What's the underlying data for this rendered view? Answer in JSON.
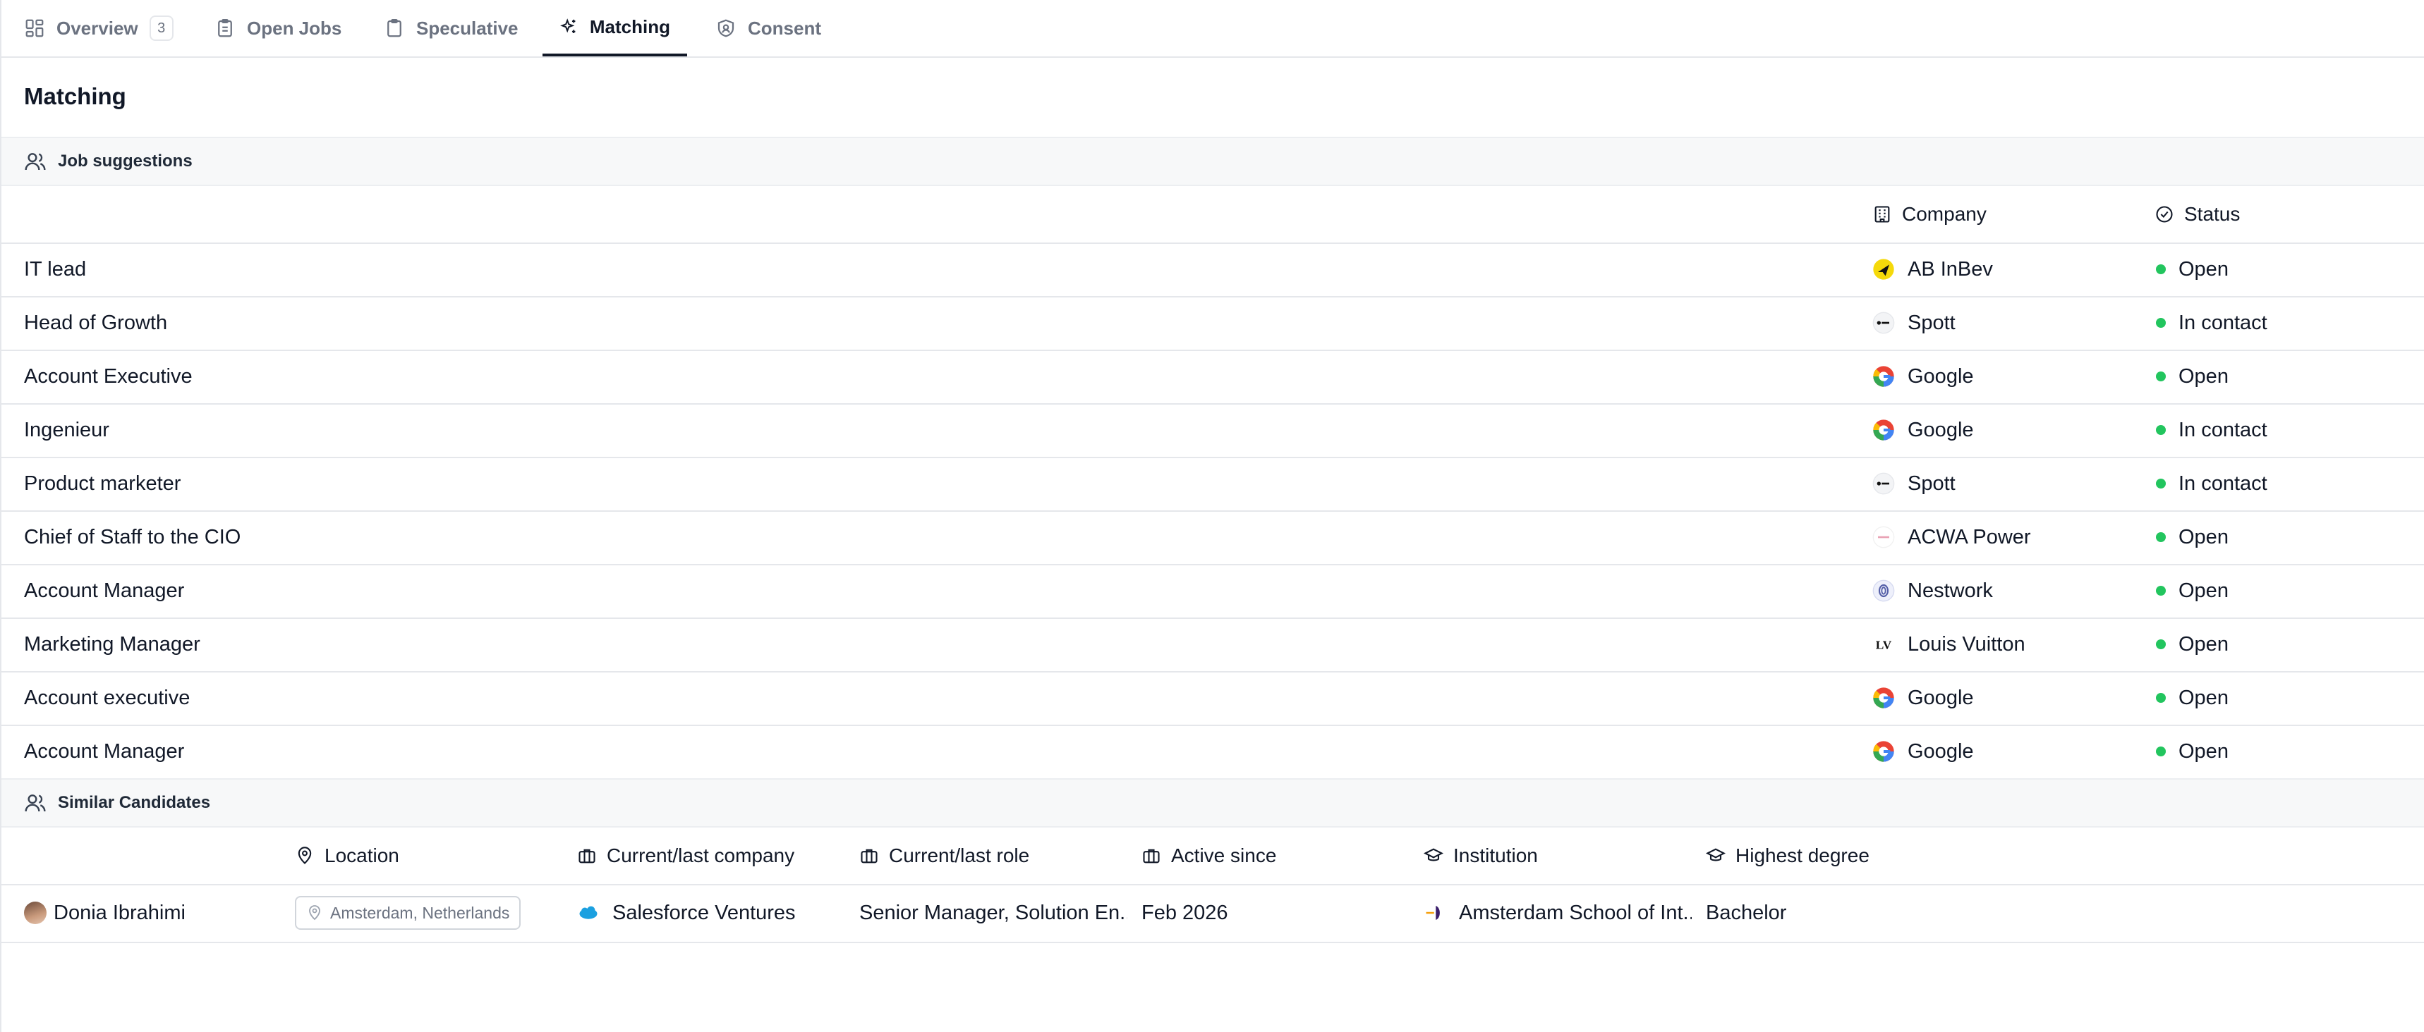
{
  "tabs": [
    {
      "label": "Overview",
      "count": "3",
      "icon": "grid-icon"
    },
    {
      "label": "Open Jobs",
      "icon": "clipboard-list-icon"
    },
    {
      "label": "Speculative",
      "icon": "clipboard-icon"
    },
    {
      "label": "Matching",
      "icon": "sparkles-icon",
      "active": true
    },
    {
      "label": "Consent",
      "icon": "shield-icon"
    }
  ],
  "page_title": "Matching",
  "job_suggestions": {
    "title": "Job suggestions",
    "columns": {
      "company": "Company",
      "status": "Status"
    },
    "rows": [
      {
        "title": "IT lead",
        "company": "AB InBev",
        "logo": "abinbev",
        "status": "Open"
      },
      {
        "title": "Head of Growth",
        "company": "Spott",
        "logo": "spott",
        "status": "In contact"
      },
      {
        "title": "Account Executive",
        "company": "Google",
        "logo": "google",
        "status": "Open"
      },
      {
        "title": "Ingenieur",
        "company": "Google",
        "logo": "google",
        "status": "In contact"
      },
      {
        "title": "Product marketer",
        "company": "Spott",
        "logo": "spott",
        "status": "In contact"
      },
      {
        "title": "Chief of Staff to the CIO",
        "company": "ACWA Power",
        "logo": "acwa",
        "status": "Open"
      },
      {
        "title": "Account Manager",
        "company": "Nestwork",
        "logo": "nestwork",
        "status": "Open"
      },
      {
        "title": "Marketing Manager",
        "company": "Louis Vuitton",
        "logo": "lv",
        "status": "Open"
      },
      {
        "title": "Account executive",
        "company": "Google",
        "logo": "google",
        "status": "Open"
      },
      {
        "title": "Account Manager",
        "company": "Google",
        "logo": "google",
        "status": "Open"
      }
    ]
  },
  "similar_candidates": {
    "title": "Similar Candidates",
    "columns": {
      "location": "Location",
      "company": "Current/last company",
      "role": "Current/last role",
      "active_since": "Active since",
      "institution": "Institution",
      "degree": "Highest degree"
    },
    "rows": [
      {
        "name": "Donia Ibrahimi",
        "location": "Amsterdam, Netherlands",
        "company": "Salesforce Ventures",
        "role": "Senior Manager, Solution En...",
        "active_since": "Feb 2026",
        "institution": "Amsterdam School of Int...",
        "degree": "Bachelor"
      }
    ]
  },
  "colors": {
    "status_open": "#22c55e",
    "accent": "#111827"
  }
}
